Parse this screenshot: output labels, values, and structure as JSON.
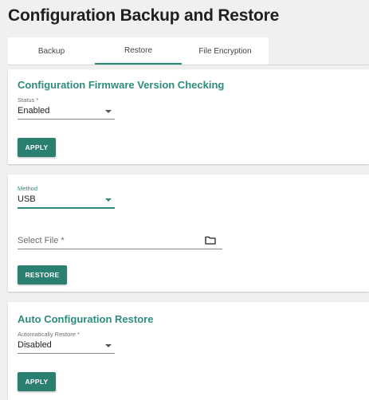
{
  "page": {
    "title": "Configuration Backup and Restore"
  },
  "tabs": [
    {
      "label": "Backup",
      "active": false
    },
    {
      "label": "Restore",
      "active": true
    },
    {
      "label": "File Encryption",
      "active": false
    }
  ],
  "firmware_check": {
    "title": "Configuration Firmware Version Checking",
    "status_label": "Status *",
    "status_value": "Enabled",
    "apply_label": "APPLY"
  },
  "restore": {
    "method_label": "Method",
    "method_value": "USB",
    "file_placeholder": "Select File *",
    "restore_label": "RESTORE"
  },
  "auto_restore": {
    "title": "Auto Configuration Restore",
    "auto_label": "Automatically Restore *",
    "auto_value": "Disabled",
    "apply_label": "APPLY"
  },
  "colors": {
    "accent": "#2d8c7c",
    "button": "#2a7f70",
    "background": "#f0f0f0"
  }
}
